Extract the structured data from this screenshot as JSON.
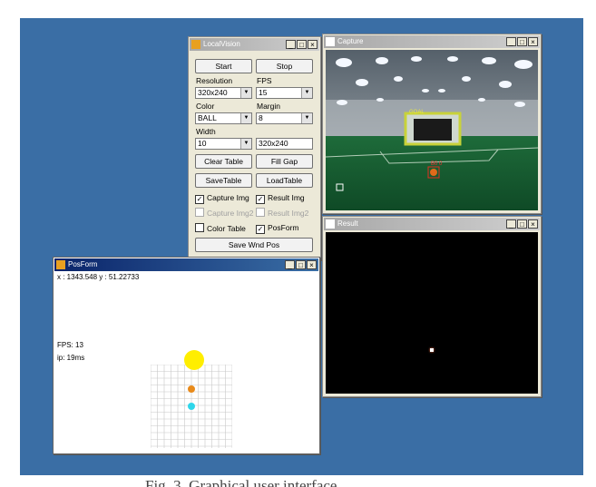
{
  "windows": {
    "localvision": {
      "title": "LocalVision",
      "start_label": "Start",
      "stop_label": "Stop",
      "resolution_label": "Resolution",
      "fps_label": "FPS",
      "resolution_value": "320x240",
      "fps_value": "15",
      "color_label": "Color",
      "margin_label": "Margin",
      "color_value": "BALL",
      "margin_value": "8",
      "width_label": "Width",
      "width_value": "10",
      "size_field_value": "320x240",
      "clear_table_label": "Clear Table",
      "fill_gap_label": "Fill Gap",
      "save_table_label": "SaveTable",
      "load_table_label": "LoadTable",
      "capture_img_label": "Capture Img",
      "result_img_label": "Result Img",
      "capture_img2_label": "Capture Img2",
      "result_img2_label": "Result Img2",
      "color_table_label": "Color Table",
      "posform_label": "PosForm",
      "save_wnd_pos_label": "Save Wnd Pos"
    },
    "capture": {
      "title": "Capture",
      "ball_tag": "B0 0",
      "goal_tag": "GOAL"
    },
    "result": {
      "title": "Result"
    },
    "posform": {
      "title": "PosForm",
      "coords": "x : 1343.548  y : 51.22733",
      "fps": "FPS: 13",
      "ip": "ip: 19ms"
    }
  },
  "caption": "Fig. 3. Graphical user interface",
  "colors": {
    "desktop": "#3a6ea5",
    "title_active": "#0a246a",
    "ball_yellow": "#ffee00",
    "ball_orange": "#e88a1a",
    "ball_cyan": "#2ed6ea",
    "goal_yellow": "#c8d23a"
  },
  "icons": {
    "minimize": "_",
    "maximize": "□",
    "close": "×",
    "dropdown": "▼",
    "check": "✓"
  }
}
